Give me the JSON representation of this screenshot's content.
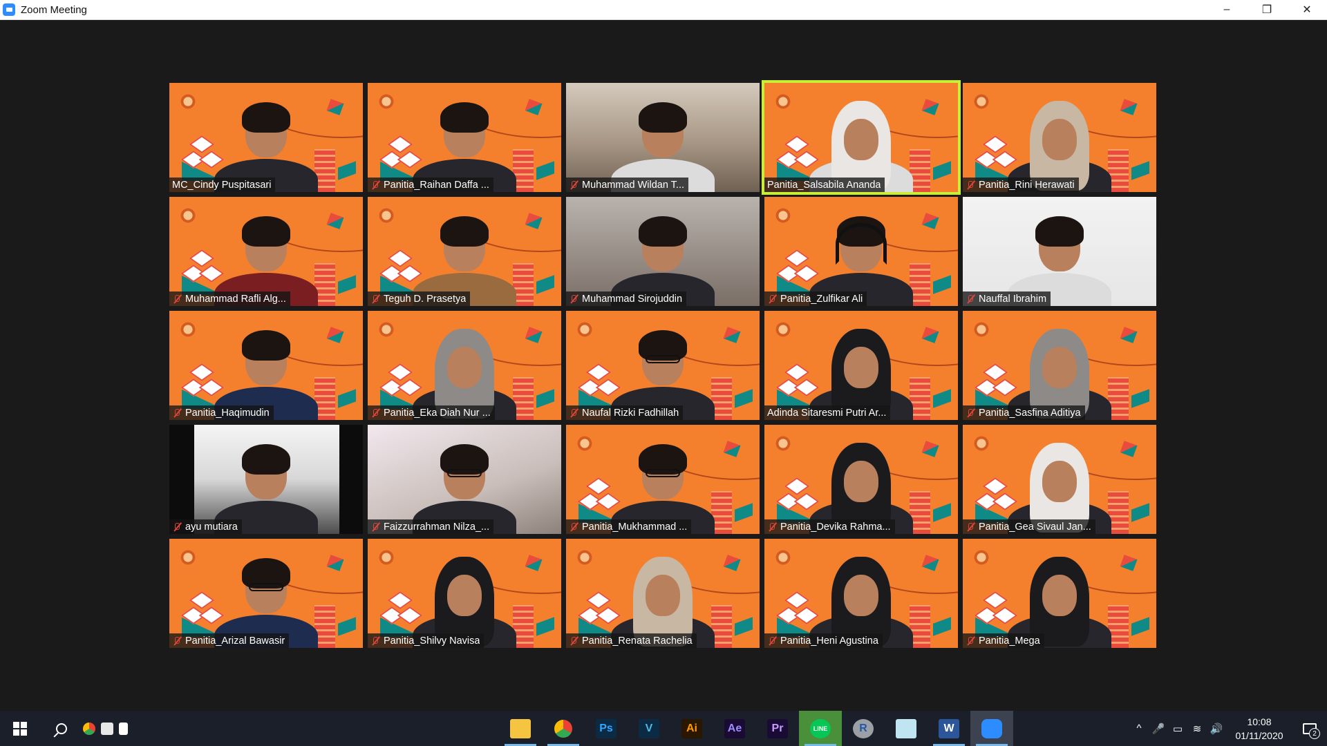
{
  "window": {
    "title": "Zoom Meeting",
    "controls": {
      "minimize": "–",
      "restore": "❐",
      "close": "✕"
    }
  },
  "participants": [
    {
      "name": "MC_Cindy Puspitasari",
      "muted": false,
      "bg": "orange",
      "look": "hair",
      "body": "black"
    },
    {
      "name": "Panitia_Raihan Daffa ...",
      "muted": true,
      "bg": "orange",
      "look": "hair",
      "body": "black"
    },
    {
      "name": "Muhammad Wildan T...",
      "muted": true,
      "bg": "room",
      "look": "hair",
      "body": "white"
    },
    {
      "name": "Panitia_Salsabila Ananda",
      "muted": false,
      "bg": "orange",
      "look": "hijab",
      "body": "white",
      "active_speaker": true
    },
    {
      "name": "Panitia_Rini Herawati",
      "muted": true,
      "bg": "orange",
      "look": "hijab-beige",
      "body": "black"
    },
    {
      "name": "Muhammad Rafli Alg...",
      "muted": true,
      "bg": "orange",
      "look": "hair",
      "body": "red"
    },
    {
      "name": "Teguh D. Prasetya",
      "muted": true,
      "bg": "orange",
      "look": "hair",
      "body": "batik"
    },
    {
      "name": "Muhammad Sirojuddin",
      "muted": true,
      "bg": "dim",
      "look": "hair",
      "body": "black"
    },
    {
      "name": "Panitia_Zulfikar Ali",
      "muted": true,
      "bg": "orange",
      "look": "headset",
      "body": "black"
    },
    {
      "name": "Nauffal Ibrahim",
      "muted": true,
      "bg": "wall",
      "look": "hair",
      "body": "white"
    },
    {
      "name": "Panitia_Haqimudin",
      "muted": true,
      "bg": "orange",
      "look": "hair",
      "body": "navy"
    },
    {
      "name": "Panitia_Eka Diah Nur ...",
      "muted": true,
      "bg": "orange",
      "look": "hijab-grey",
      "body": "black"
    },
    {
      "name": "Naufal Rizki Fadhillah",
      "muted": true,
      "bg": "orange",
      "look": "glasses",
      "body": "black"
    },
    {
      "name": "Adinda Sitaresmi Putri Ar...",
      "muted": false,
      "bg": "orange",
      "look": "hijab-dark",
      "body": "black"
    },
    {
      "name": "Panitia_Sasfina Aditiya",
      "muted": true,
      "bg": "orange",
      "look": "hijab-grey",
      "body": "black"
    },
    {
      "name": "ayu mutiara",
      "muted": true,
      "bg": "dark",
      "look": "hair",
      "body": "black"
    },
    {
      "name": "Faizzurrahman Nilza_...",
      "muted": true,
      "bg": "pink",
      "look": "glasses",
      "body": "black"
    },
    {
      "name": "Panitia_Mukhammad ...",
      "muted": true,
      "bg": "orange",
      "look": "glasses",
      "body": "black"
    },
    {
      "name": "Panitia_Devika Rahma...",
      "muted": true,
      "bg": "orange",
      "look": "hijab-dark",
      "body": "black"
    },
    {
      "name": "Panitia_Gea Sivaul Jan...",
      "muted": true,
      "bg": "orange",
      "look": "hijab",
      "body": "black"
    },
    {
      "name": "Panitia_Arizal Bawasir",
      "muted": true,
      "bg": "orange",
      "look": "glasses",
      "body": "navy"
    },
    {
      "name": "Panitia_Shilvy Navisa",
      "muted": true,
      "bg": "orange",
      "look": "hijab-dark",
      "body": "black"
    },
    {
      "name": "Panitia_Renata Rachelia",
      "muted": true,
      "bg": "orange",
      "look": "hijab-beige",
      "body": "black"
    },
    {
      "name": "Panitia_Heni Agustina",
      "muted": true,
      "bg": "orange",
      "look": "hijab-dark",
      "body": "black"
    },
    {
      "name": "Panitia_Mega",
      "muted": true,
      "bg": "orange",
      "look": "hijab-dark",
      "body": "black"
    }
  ],
  "taskbar": {
    "pinned_small": [
      "chrome-mini",
      "amazon-mini",
      "file-mini"
    ],
    "apps": [
      {
        "icon": "file-explorer-icon",
        "label": "",
        "bg": "#f5c542",
        "fg": "#f5c542",
        "running": true
      },
      {
        "icon": "chrome-icon",
        "label": "",
        "bg": "#ffffff",
        "fg": "#333",
        "running": true
      },
      {
        "icon": "photoshop-icon",
        "label": "Ps",
        "bg": "#0b2a44",
        "fg": "#31a8ff",
        "running": false
      },
      {
        "icon": "vegas-icon",
        "label": "V",
        "bg": "#0b2a44",
        "fg": "#4fb7e6",
        "running": false
      },
      {
        "icon": "illustrator-icon",
        "label": "Ai",
        "bg": "#2b1600",
        "fg": "#ff9a00",
        "running": false
      },
      {
        "icon": "after-effects-icon",
        "label": "Ae",
        "bg": "#1a0b35",
        "fg": "#9d8cff",
        "running": false
      },
      {
        "icon": "premiere-icon",
        "label": "Pr",
        "bg": "#1a0b35",
        "fg": "#c99bff",
        "running": false
      },
      {
        "icon": "line-icon",
        "label": "LINE",
        "bg": "#06c755",
        "fg": "#ffffff",
        "running": true
      },
      {
        "icon": "r-icon",
        "label": "R",
        "bg": "#9aa0a6",
        "fg": "#1f5aa6",
        "running": false
      },
      {
        "icon": "notepad-icon",
        "label": "",
        "bg": "#bfe4f2",
        "fg": "#555",
        "running": false
      },
      {
        "icon": "word-icon",
        "label": "W",
        "bg": "#2b579a",
        "fg": "#ffffff",
        "running": true
      },
      {
        "icon": "zoom-icon",
        "label": "",
        "bg": "#2d8cff",
        "fg": "#ffffff",
        "running": true,
        "active": true
      }
    ],
    "tray": {
      "chevron": "^",
      "mic": "🎤",
      "battery": "▭",
      "wifi": "≋",
      "volume": "🔊",
      "time": "10:08",
      "date": "01/11/2020",
      "notification_count": "2"
    }
  },
  "colors": {
    "stage_bg": "#1a1a1a",
    "active_speaker_border": "#c9ee3a",
    "muted_icon": "#e0453b",
    "zoom_blue": "#2d8cff",
    "taskbar_bg": "#1b1f2a"
  }
}
